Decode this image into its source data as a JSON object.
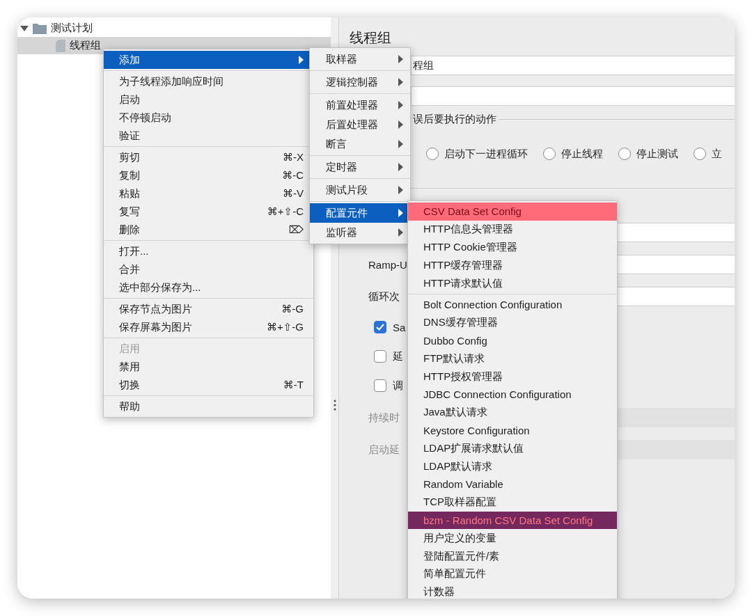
{
  "tree": [
    {
      "label": "测试计划",
      "expanded": true,
      "selected": false,
      "children": [
        {
          "label": "线程组",
          "selected": true
        }
      ]
    }
  ],
  "panel": {
    "title": "线程组",
    "name_field": {
      "value": "程组"
    },
    "legend": "误后要执行的动作",
    "radios": [
      {
        "label": "启动下一进程循环",
        "selected": false
      },
      {
        "label": "停止线程",
        "selected": false
      },
      {
        "label": "停止测试",
        "selected": false
      },
      {
        "label": "立",
        "selected": false
      }
    ],
    "rows": [
      {
        "kind": "field",
        "disabled": false
      },
      {
        "kind": "field",
        "label": "Ramp-U",
        "disabled": false
      },
      {
        "kind": "field",
        "label": "循环次",
        "disabled": false
      },
      {
        "kind": "checkbox",
        "label": "Sa",
        "checked": true
      },
      {
        "kind": "checkbox",
        "label": "延",
        "checked": false
      },
      {
        "kind": "checkbox",
        "label": "调",
        "checked": false
      },
      {
        "kind": "field",
        "label": "持续时",
        "disabled": true
      },
      {
        "kind": "field",
        "label": "启动延",
        "disabled": true
      }
    ]
  },
  "context_menu": {
    "groups": [
      [
        {
          "label": "添加",
          "submenu": true,
          "selected": true,
          "disabled": false
        }
      ],
      [
        {
          "label": "为子线程添加响应时间",
          "submenu": false,
          "selected": false,
          "disabled": false
        },
        {
          "label": "启动",
          "submenu": false,
          "selected": false,
          "disabled": false
        },
        {
          "label": "不停顿启动",
          "submenu": false,
          "selected": false,
          "disabled": false
        },
        {
          "label": "验证",
          "submenu": false,
          "selected": false,
          "disabled": false
        }
      ],
      [
        {
          "label": "剪切",
          "shortcut": "⌘-X",
          "submenu": false,
          "selected": false,
          "disabled": false
        },
        {
          "label": "复制",
          "shortcut": "⌘-C",
          "submenu": false,
          "selected": false,
          "disabled": false
        },
        {
          "label": "粘贴",
          "shortcut": "⌘-V",
          "submenu": false,
          "selected": false,
          "disabled": false
        },
        {
          "label": "复写",
          "shortcut": "⌘+⇧-C",
          "submenu": false,
          "selected": false,
          "disabled": false
        },
        {
          "label": "删除",
          "shortcut": "⌦",
          "submenu": false,
          "selected": false,
          "disabled": false
        }
      ],
      [
        {
          "label": "打开...",
          "submenu": false,
          "selected": false,
          "disabled": false
        },
        {
          "label": "合并",
          "submenu": false,
          "selected": false,
          "disabled": false
        },
        {
          "label": "选中部分保存为...",
          "submenu": false,
          "selected": false,
          "disabled": false
        }
      ],
      [
        {
          "label": "保存节点为图片",
          "shortcut": "⌘-G",
          "submenu": false,
          "selected": false,
          "disabled": false
        },
        {
          "label": "保存屏幕为图片",
          "shortcut": "⌘+⇧-G",
          "submenu": false,
          "selected": false,
          "disabled": false
        }
      ],
      [
        {
          "label": "启用",
          "submenu": false,
          "selected": false,
          "disabled": true
        },
        {
          "label": "禁用",
          "submenu": false,
          "selected": false,
          "disabled": false
        },
        {
          "label": "切换",
          "shortcut": "⌘-T",
          "submenu": false,
          "selected": false,
          "disabled": false
        }
      ],
      [
        {
          "label": "帮助",
          "submenu": false,
          "selected": false,
          "disabled": false
        }
      ]
    ]
  },
  "add_menu": {
    "groups": [
      [
        {
          "label": "取样器",
          "submenu": true,
          "selected": false
        }
      ],
      [
        {
          "label": "逻辑控制器",
          "submenu": true,
          "selected": false
        }
      ],
      [
        {
          "label": "前置处理器",
          "submenu": true,
          "selected": false
        },
        {
          "label": "后置处理器",
          "submenu": true,
          "selected": false
        },
        {
          "label": "断言",
          "submenu": true,
          "selected": false
        }
      ],
      [
        {
          "label": "定时器",
          "submenu": true,
          "selected": false
        }
      ],
      [
        {
          "label": "测试片段",
          "submenu": true,
          "selected": false
        }
      ],
      [
        {
          "label": "配置元件",
          "submenu": true,
          "selected": true
        },
        {
          "label": "监听器",
          "submenu": true,
          "selected": false
        }
      ]
    ]
  },
  "config_menu": {
    "groups": [
      [
        {
          "label": "CSV Data Set Config",
          "kind": "marked-red"
        },
        {
          "label": "HTTP信息头管理器",
          "kind": "plain"
        },
        {
          "label": "HTTP Cookie管理器",
          "kind": "plain"
        },
        {
          "label": "HTTP缓存管理器",
          "kind": "plain"
        },
        {
          "label": "HTTP请求默认值",
          "kind": "plain"
        }
      ],
      [
        {
          "label": "Bolt Connection Configuration",
          "kind": "plain"
        },
        {
          "label": "DNS缓存管理器",
          "kind": "plain"
        },
        {
          "label": "Dubbo Config",
          "kind": "plain"
        },
        {
          "label": "FTP默认请求",
          "kind": "plain"
        },
        {
          "label": "HTTP授权管理器",
          "kind": "plain"
        },
        {
          "label": "JDBC Connection Configuration",
          "kind": "plain"
        },
        {
          "label": "Java默认请求",
          "kind": "plain"
        },
        {
          "label": "Keystore Configuration",
          "kind": "plain"
        },
        {
          "label": "LDAP扩展请求默认值",
          "kind": "plain"
        },
        {
          "label": "LDAP默认请求",
          "kind": "plain"
        },
        {
          "label": "Random Variable",
          "kind": "plain"
        },
        {
          "label": "TCP取样器配置",
          "kind": "plain"
        },
        {
          "label": "bzm - Random CSV Data Set Config",
          "kind": "marked-purple"
        },
        {
          "label": "用户定义的变量",
          "kind": "plain"
        },
        {
          "label": "登陆配置元件/素",
          "kind": "plain"
        },
        {
          "label": "简单配置元件",
          "kind": "plain"
        },
        {
          "label": "计数器",
          "kind": "plain"
        }
      ]
    ]
  }
}
